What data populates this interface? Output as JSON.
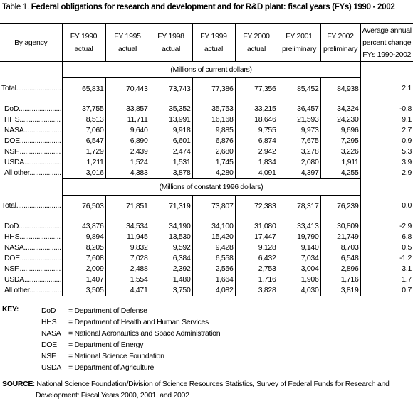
{
  "title": {
    "lead": "Table 1.",
    "main": "Federal obligations for research and development and for R&D plant: fiscal years (FYs) 1990 - 2002"
  },
  "table": {
    "header": {
      "agency": "By agency",
      "columns": [
        {
          "year": "FY 1990",
          "status": "actual"
        },
        {
          "year": "FY 1995",
          "status": "actual"
        },
        {
          "year": "FY 1998",
          "status": "actual"
        },
        {
          "year": "FY 1999",
          "status": "actual"
        },
        {
          "year": "FY 2000",
          "status": "actual"
        },
        {
          "year": "FY 2001",
          "status": "preliminary"
        },
        {
          "year": "FY 2002",
          "status": "preliminary"
        }
      ],
      "avg": [
        "Average annual",
        "percent change",
        "FYs 1990-2002"
      ]
    },
    "sections": [
      {
        "unit": "(Millions of current dollars)",
        "total": {
          "label": "Total",
          "values": [
            "65,831",
            "70,443",
            "73,743",
            "77,386",
            "77,356",
            "85,452",
            "84,938"
          ],
          "pct": "2.1"
        },
        "rows": [
          {
            "label": "DoD",
            "values": [
              "37,755",
              "33,857",
              "35,352",
              "35,753",
              "33,215",
              "36,457",
              "34,324"
            ],
            "pct": "-0.8"
          },
          {
            "label": "HHS",
            "values": [
              "8,513",
              "11,711",
              "13,991",
              "16,168",
              "18,646",
              "21,593",
              "24,230"
            ],
            "pct": "9.1"
          },
          {
            "label": "NASA",
            "values": [
              "7,060",
              "9,640",
              "9,918",
              "9,885",
              "9,755",
              "9,973",
              "9,696"
            ],
            "pct": "2.7"
          },
          {
            "label": "DOE",
            "values": [
              "6,547",
              "6,890",
              "6,601",
              "6,876",
              "6,874",
              "7,675",
              "7,295"
            ],
            "pct": "0.9"
          },
          {
            "label": "NSF",
            "values": [
              "1,729",
              "2,439",
              "2,474",
              "2,680",
              "2,942",
              "3,278",
              "3,226"
            ],
            "pct": "5.3"
          },
          {
            "label": "USDA",
            "values": [
              "1,211",
              "1,524",
              "1,531",
              "1,745",
              "1,834",
              "2,080",
              "1,911"
            ],
            "pct": "3.9"
          },
          {
            "label": "All other",
            "values": [
              "3,016",
              "4,383",
              "3,878",
              "4,280",
              "4,091",
              "4,397",
              "4,255"
            ],
            "pct": "2.9"
          }
        ]
      },
      {
        "unit": "(Millions of constant 1996 dollars)",
        "total": {
          "label": "Total",
          "values": [
            "76,503",
            "71,851",
            "71,319",
            "73,807",
            "72,383",
            "78,317",
            "76,239"
          ],
          "pct": "0.0"
        },
        "rows": [
          {
            "label": "DoD",
            "values": [
              "43,876",
              "34,534",
              "34,190",
              "34,100",
              "31,080",
              "33,413",
              "30,809"
            ],
            "pct": "-2.9"
          },
          {
            "label": "HHS",
            "values": [
              "9,894",
              "11,945",
              "13,530",
              "15,420",
              "17,447",
              "19,790",
              "21,749"
            ],
            "pct": "6.8"
          },
          {
            "label": "NASA",
            "values": [
              "8,205",
              "9,832",
              "9,592",
              "9,428",
              "9,128",
              "9,140",
              "8,703"
            ],
            "pct": "0.5"
          },
          {
            "label": "DOE",
            "values": [
              "7,608",
              "7,028",
              "6,384",
              "6,558",
              "6,432",
              "7,034",
              "6,548"
            ],
            "pct": "-1.2"
          },
          {
            "label": "NSF",
            "values": [
              "2,009",
              "2,488",
              "2,392",
              "2,556",
              "2,753",
              "3,004",
              "2,896"
            ],
            "pct": "3.1"
          },
          {
            "label": "USDA",
            "values": [
              "1,407",
              "1,554",
              "1,480",
              "1,664",
              "1,716",
              "1,906",
              "1,716"
            ],
            "pct": "1.7"
          },
          {
            "label": "All other",
            "values": [
              "3,505",
              "4,471",
              "3,750",
              "4,082",
              "3,828",
              "4,030",
              "3,819"
            ],
            "pct": "0.7"
          }
        ]
      }
    ]
  },
  "key": {
    "label": "KEY:",
    "entries": [
      {
        "abbr": "DoD",
        "meaning": "= Department of Defense"
      },
      {
        "abbr": "HHS",
        "meaning": "= Department of Health and Human Services"
      },
      {
        "abbr": "NASA",
        "meaning": "= National Aeronautics and Space Administration"
      },
      {
        "abbr": "DOE",
        "meaning": "= Department of Energy"
      },
      {
        "abbr": "NSF",
        "meaning": "= National Science Foundation"
      },
      {
        "abbr": "USDA",
        "meaning": "= Department of Agriculture"
      }
    ]
  },
  "source": {
    "label": "SOURCE",
    "line1": ":  National Science Foundation/Division of Science Resources Statistics, Survey of Federal Funds for Research and",
    "line2": "Development:  Fiscal Years 2000, 2001, and 2002"
  }
}
